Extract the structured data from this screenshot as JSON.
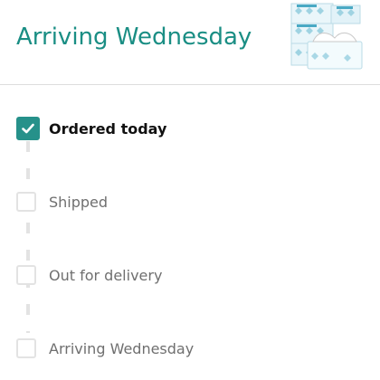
{
  "header": {
    "title": "Arriving Wednesday",
    "product_image": "tissue-boxes-thumbnail"
  },
  "progress": {
    "steps": [
      {
        "label": "Ordered today",
        "status": "complete",
        "icon": "check-icon"
      },
      {
        "label": "Shipped",
        "status": "pending"
      },
      {
        "label": "Out for delivery",
        "status": "pending"
      },
      {
        "label": "Arriving Wednesday",
        "status": "pending"
      }
    ]
  },
  "colors": {
    "accent": "#1a8e84",
    "check_fill": "#26918a",
    "pending_border": "#e3e3e3",
    "pending_text": "#6f6f6f"
  }
}
